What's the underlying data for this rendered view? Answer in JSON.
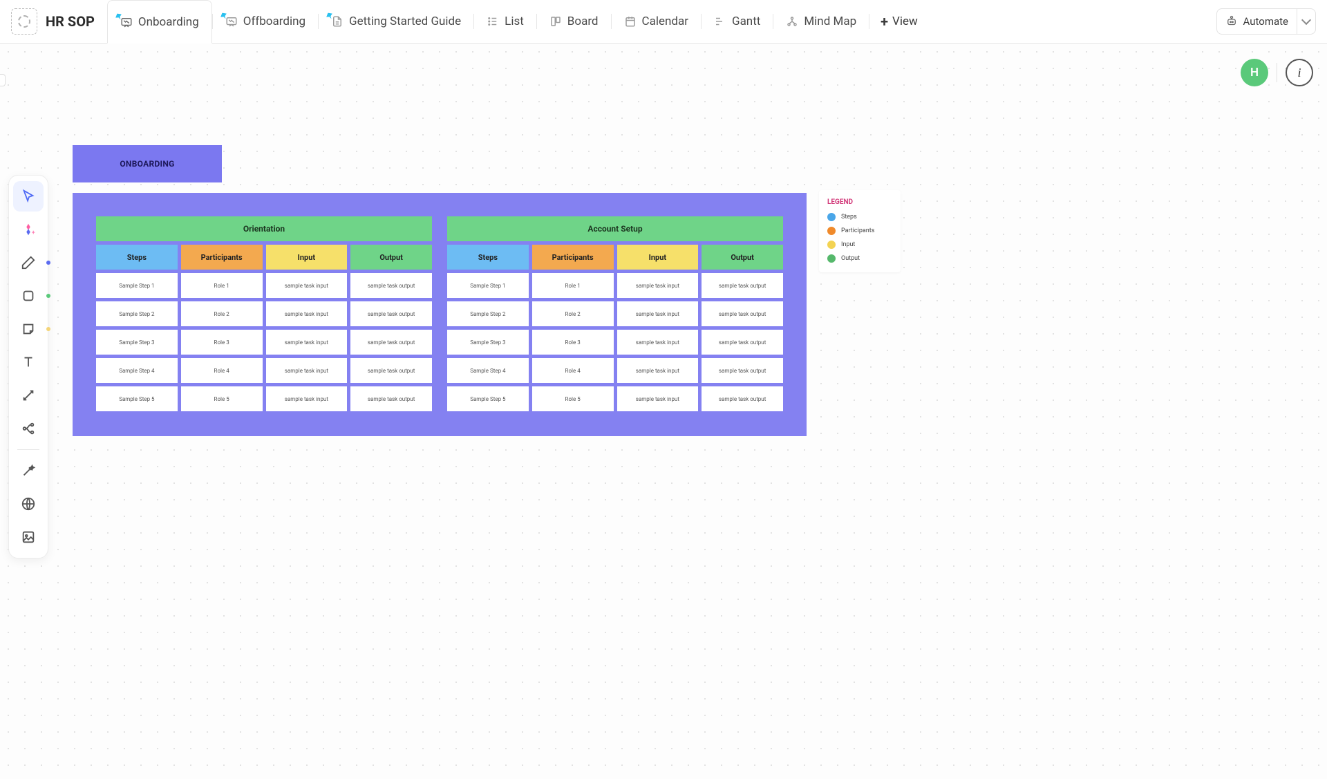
{
  "header": {
    "title": "HR SOP",
    "tabs": [
      {
        "label": "Onboarding",
        "active": true,
        "pinned": true
      },
      {
        "label": "Offboarding",
        "active": false,
        "pinned": true
      },
      {
        "label": "Getting Started Guide",
        "active": false,
        "pinned": true
      },
      {
        "label": "List",
        "active": false,
        "pinned": false
      },
      {
        "label": "Board",
        "active": false,
        "pinned": false
      },
      {
        "label": "Calendar",
        "active": false,
        "pinned": false
      },
      {
        "label": "Gantt",
        "active": false,
        "pinned": false
      },
      {
        "label": "Mind Map",
        "active": false,
        "pinned": false
      }
    ],
    "add_view_label": "View",
    "automate_label": "Automate"
  },
  "avatar_initial": "H",
  "board_header": "ONBOARDING",
  "columns": {
    "steps": "Steps",
    "participants": "Participants",
    "input": "Input",
    "output": "Output"
  },
  "sections": [
    {
      "title": "Orientation",
      "rows": [
        {
          "step": "Sample Step 1",
          "role": "Role 1",
          "input": "sample task input",
          "output": "sample task output"
        },
        {
          "step": "Sample Step 2",
          "role": "Role 2",
          "input": "sample task input",
          "output": "sample task output"
        },
        {
          "step": "Sample Step 3",
          "role": "Role 3",
          "input": "sample task input",
          "output": "sample task output"
        },
        {
          "step": "Sample Step 4",
          "role": "Role 4",
          "input": "sample task input",
          "output": "sample task output"
        },
        {
          "step": "Sample Step 5",
          "role": "Role 5",
          "input": "sample task input",
          "output": "sample task output"
        }
      ]
    },
    {
      "title": "Account Setup",
      "rows": [
        {
          "step": "Sample Step 1",
          "role": "Role 1",
          "input": "sample task input",
          "output": "sample task output"
        },
        {
          "step": "Sample Step 2",
          "role": "Role 2",
          "input": "sample task input",
          "output": "sample task output"
        },
        {
          "step": "Sample Step 3",
          "role": "Role 3",
          "input": "sample task input",
          "output": "sample task output"
        },
        {
          "step": "Sample Step 4",
          "role": "Role 4",
          "input": "sample task input",
          "output": "sample task output"
        },
        {
          "step": "Sample Step 5",
          "role": "Role 5",
          "input": "sample task input",
          "output": "sample task output"
        }
      ]
    }
  ],
  "legend": {
    "title": "LEGEND",
    "items": [
      {
        "label": "Steps",
        "color": "#4aa6e8"
      },
      {
        "label": "Participants",
        "color": "#f08a2b"
      },
      {
        "label": "Input",
        "color": "#f3d352"
      },
      {
        "label": "Output",
        "color": "#55b86b"
      }
    ]
  },
  "colors": {
    "purple": "#8481f1",
    "purple_header": "#7b78f0",
    "green": "#6fd488",
    "blue": "#6dbcf3",
    "orange": "#f3a94f",
    "yellow": "#f6e06a"
  }
}
